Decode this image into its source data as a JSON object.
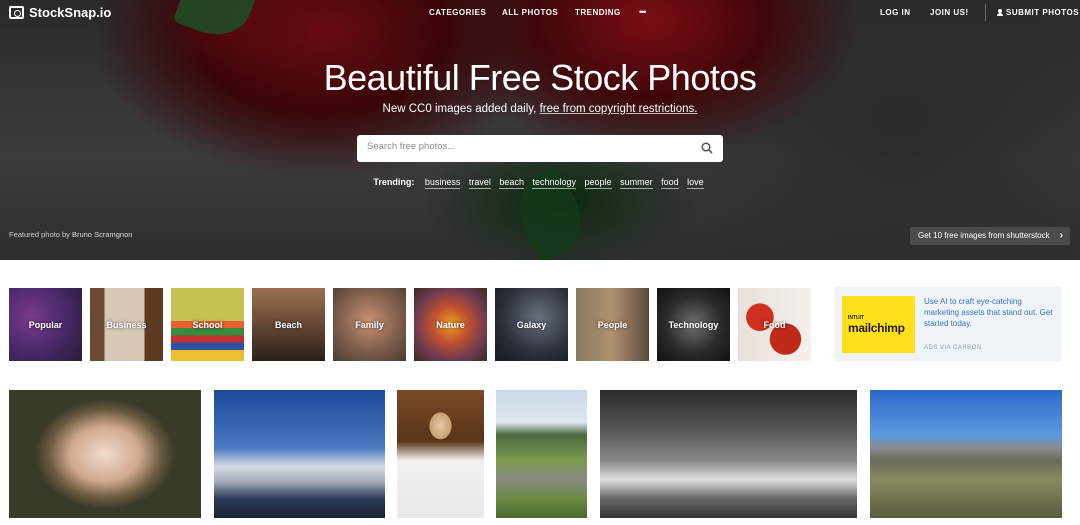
{
  "nav": {
    "logo": "StockSnap.io",
    "links": [
      "CATEGORIES",
      "ALL PHOTOS",
      "TRENDING"
    ],
    "more": "•••",
    "log_in": "LOG IN",
    "join": "JOIN US!",
    "submit": "SUBMIT PHOTOS"
  },
  "hero": {
    "title": "Beautiful Free Stock Photos",
    "subtitle_prefix": "New CC0 images added daily, ",
    "subtitle_link": "free from copyright restrictions.",
    "search_placeholder": "Search free photos...",
    "trending_label": "Trending:",
    "trending_terms": [
      "business",
      "travel",
      "beach",
      "technology",
      "people",
      "summer",
      "food",
      "love"
    ],
    "featured_prefix": "Featured photo by ",
    "featured_author": "Bruno Scramgnon",
    "shutterstock_cta": "Get 10 free images from shutterstock"
  },
  "categories": [
    "Popular",
    "Business",
    "School",
    "Beach",
    "Family",
    "Nature",
    "Galaxy",
    "People",
    "Technology",
    "Food"
  ],
  "ad": {
    "brand_small": "INTUIT",
    "brand": "mailchimp",
    "text": "Use AI to craft eye-catching marketing assets that stand out. Get started today.",
    "via": "ADS VIA CARBON"
  },
  "photos": [
    "rose-photo",
    "clouds-photo",
    "woman-phone-photo",
    "road-photo",
    "surfer-photo",
    "desert-photo"
  ],
  "icons": {
    "search": "search-icon",
    "logo": "camera-icon",
    "user": "user-icon",
    "chevron": "chevron-right-icon"
  }
}
